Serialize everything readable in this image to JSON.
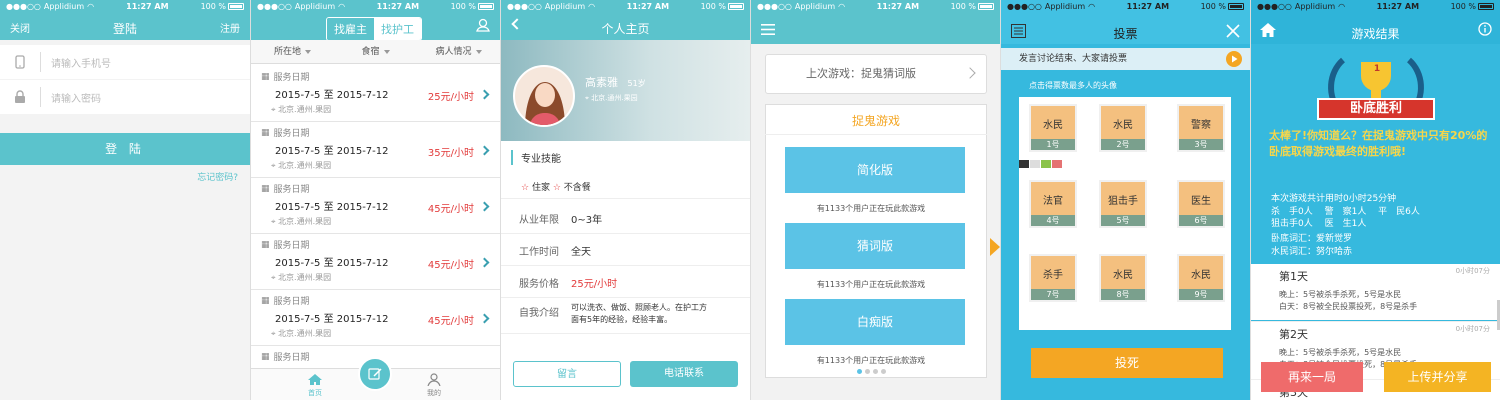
{
  "status": {
    "carrier": "Applidium",
    "time": "11:27 AM",
    "battery": "100 %"
  },
  "login": {
    "title": "登陆",
    "close": "关闭",
    "register": "注册",
    "phone_placeholder": "请输入手机号",
    "password_placeholder": "请输入密码",
    "login_button": "登 陆",
    "forgot": "忘记密码?"
  },
  "jobs": {
    "tab_employer": "找雇主",
    "tab_worker": "找护工",
    "filters": [
      "所在地",
      "食宿",
      "病人情况"
    ],
    "items": [
      {
        "label": "服务日期",
        "date": "2015-7-5 至 2015-7-12",
        "location": "北京.通州.果园",
        "price": "25元/小时"
      },
      {
        "label": "服务日期",
        "date": "2015-7-5 至 2015-7-12",
        "location": "北京.通州.果园",
        "price": "35元/小时"
      },
      {
        "label": "服务日期",
        "date": "2015-7-5 至 2015-7-12",
        "location": "北京.通州.果园",
        "price": "45元/小时"
      },
      {
        "label": "服务日期",
        "date": "2015-7-5 至 2015-7-12",
        "location": "北京.通州.果园",
        "price": "45元/小时"
      },
      {
        "label": "服务日期",
        "date": "2015-7-5 至 2015-7-12",
        "location": "北京.通州.果园",
        "price": "45元/小时"
      },
      {
        "label": "服务日期"
      }
    ],
    "tabbar": {
      "home": "首页",
      "mine": "我的"
    }
  },
  "profile": {
    "title": "个人主页",
    "name": "高素雅",
    "age": "51岁",
    "location": "北京.通州.果园",
    "skills_header": "专业技能",
    "tag1": "住家",
    "tag2": "不含餐",
    "rows": [
      {
        "k": "从业年限",
        "v": "0~3年"
      },
      {
        "k": "工作时间",
        "v": "全天"
      },
      {
        "k": "服务价格",
        "v": "25元/小时"
      },
      {
        "k": "自我介绍",
        "v": "可以洗衣、做饭、照顾老人。在护工方面有5年的经验，经验丰富。"
      }
    ],
    "message_button": "留言",
    "call_button": "电话联系"
  },
  "games": {
    "last_game": "上次游戏：捉鬼猜词版",
    "section_title": "捉鬼游戏",
    "versions": [
      {
        "name": "简化版",
        "users": "有1133个用户正在玩此款游戏"
      },
      {
        "name": "猜词版",
        "users": "有1133个用户正在玩此款游戏"
      },
      {
        "name": "白痴版",
        "users": "有1133个用户正在玩此款游戏"
      }
    ]
  },
  "vote": {
    "title": "投票",
    "notice": "发言讨论结束、大家请投票",
    "hint": "点击得票数最多人的头像",
    "cards": [
      {
        "name": "水民",
        "no": "1号"
      },
      {
        "name": "水民",
        "no": "2号"
      },
      {
        "name": "警察",
        "no": "3号"
      },
      {
        "name": "法官",
        "no": "4号"
      },
      {
        "name": "狙击手",
        "no": "5号"
      },
      {
        "name": "医生",
        "no": "6号"
      },
      {
        "name": "杀手",
        "no": "7号"
      },
      {
        "name": "水民",
        "no": "8号"
      },
      {
        "name": "水民",
        "no": "9号"
      }
    ],
    "vote_button": "投死"
  },
  "result": {
    "title": "游戏结果",
    "banner": "卧底胜利",
    "rank": "1",
    "headline": "太棒了!你知道么？在捉鬼游戏中只有20%的卧底取得游戏最终的胜利哦!",
    "total_time": "本次游戏共计用时0小时25分钟",
    "roles_line1": "杀　手0人　 警　察1人　 平　民6人",
    "roles_line2": "狙击手0人　 医　生1人",
    "undercover_word": "卧底词汇：爱新觉罗",
    "civilian_word": "水民词汇：努尔哈赤",
    "days": [
      {
        "title": "第1天",
        "time": "0小时07分",
        "lines": [
          "晚上：5号被杀手杀死，5号是水民",
          "白天：8号被全民投票投死，8号是杀手"
        ]
      },
      {
        "title": "第2天",
        "time": "0小时07分",
        "lines": [
          "晚上：5号被杀手杀死，5号是水民",
          "白天：8号被全民投票投死，8号是杀手"
        ]
      },
      {
        "title": "第3天"
      }
    ],
    "replay_button": "再来一局",
    "share_button": "上传并分享"
  }
}
